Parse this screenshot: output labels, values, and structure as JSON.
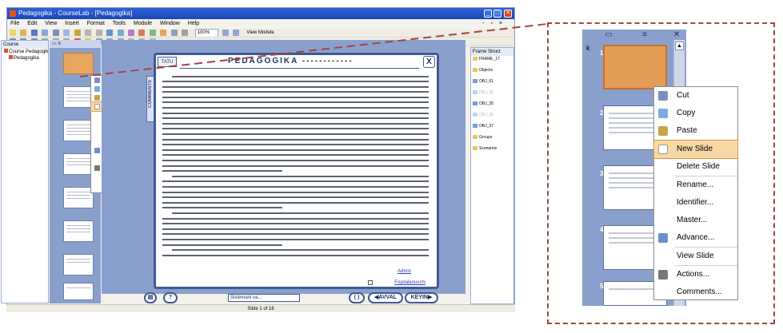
{
  "window": {
    "title": "Pedagogika - CourseLab - [Pedagogika]",
    "min": "_",
    "max": "□",
    "close": "✕"
  },
  "menubar": {
    "items": [
      "File",
      "Edit",
      "View",
      "Insert",
      "Format",
      "Tools",
      "Module",
      "Window",
      "Help"
    ],
    "mdi_controls": "- ▫ ×"
  },
  "toolbar": {
    "zoom": "100%",
    "view_module": "View Module"
  },
  "course_panel": {
    "title": "Course",
    "root": "Course Pedagogik",
    "child": "Pedagogika"
  },
  "context_menu": {
    "items": [
      {
        "label": "Cut",
        "icon": "scissors-icon",
        "color": "#7a8fbf"
      },
      {
        "label": "Copy",
        "icon": "copy-icon",
        "color": "#7da9e0"
      },
      {
        "label": "Paste",
        "icon": "paste-icon",
        "color": "#c9a548"
      },
      {
        "label": "New Slide",
        "icon": "new-slide-icon",
        "color": "#ffffff",
        "highlighted": true
      },
      {
        "label": "Delete Slide",
        "icon": "",
        "color": ""
      },
      {
        "label": "Rename...",
        "icon": "",
        "color": ""
      },
      {
        "label": "Identifier...",
        "icon": "",
        "color": ""
      },
      {
        "label": "Master...",
        "icon": "",
        "color": ""
      },
      {
        "label": "Advance...",
        "icon": "advance-icon",
        "color": "#6d8fd0"
      },
      {
        "label": "View Slide",
        "icon": "",
        "color": ""
      },
      {
        "label": "Actions...",
        "icon": "actions-icon",
        "color": "#777777"
      },
      {
        "label": "Comments...",
        "icon": "",
        "color": ""
      }
    ]
  },
  "slide": {
    "tab": "TATU",
    "title": "PEDAGOGIKA ------------",
    "close": "X",
    "comments_tab": "COMMENTS",
    "admin_link": "Admin",
    "foydalanuvchi_link": "Foydalanuvchi"
  },
  "navigation": {
    "help": "?",
    "select_text": "Sistemani va...",
    "loop": "( )",
    "prev": "AVVAL",
    "next": "KEYIN"
  },
  "status": {
    "slide_info": "Slide 1 of 16"
  },
  "frame_panel": {
    "title": "Frame Struct",
    "items": [
      {
        "label": "FRAME_17",
        "dim": false
      },
      {
        "label": "Objects",
        "dim": false
      },
      {
        "label": "OBJ_61",
        "dim": false
      },
      {
        "label": "OBJ_36",
        "dim": true
      },
      {
        "label": "OBJ_35",
        "dim": false
      },
      {
        "label": "OBJ_38",
        "dim": true
      },
      {
        "label": "OBJ_37",
        "dim": false
      },
      {
        "label": "Groups",
        "dim": false
      },
      {
        "label": "Scenarios",
        "dim": false
      }
    ]
  },
  "zoomed": {
    "stray_letter": "k",
    "slide_numbers": [
      "1",
      "2",
      "3",
      "4",
      "5"
    ]
  },
  "colors": {
    "titlebar": "#1a47b8",
    "selected_slide": "#e49d57",
    "highlight": "#f8d9a5",
    "callout_border": "#a34341"
  }
}
